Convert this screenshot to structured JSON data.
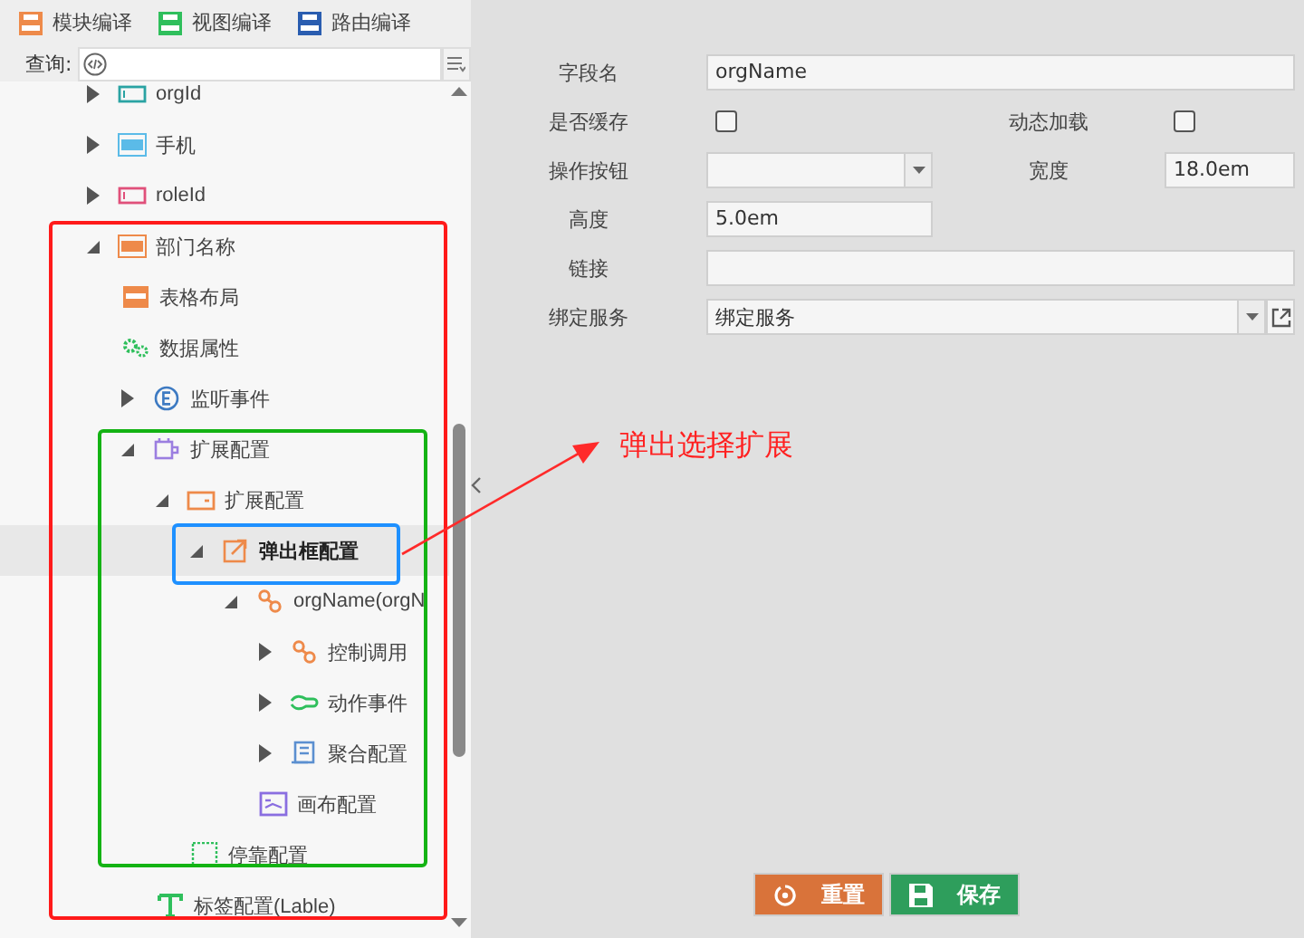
{
  "toolbar": [
    {
      "label": "模块编译"
    },
    {
      "label": "视图编译"
    },
    {
      "label": "路由编译"
    }
  ],
  "search": {
    "label": "查询:"
  },
  "tree": [
    {
      "label": "orgId",
      "expanded": false,
      "selected": false
    },
    {
      "label": "手机",
      "expanded": false,
      "selected": false
    },
    {
      "label": "roleId",
      "expanded": false,
      "selected": false
    },
    {
      "label": "部门名称",
      "expanded": true,
      "selected": false,
      "children": [
        {
          "label": "表格布局",
          "selected": false
        },
        {
          "label": "数据属性",
          "selected": false
        },
        {
          "label": "监听事件",
          "expanded": false,
          "selected": false
        },
        {
          "label": "扩展配置",
          "expanded": true,
          "selected": false,
          "children": [
            {
              "label": "扩展配置",
              "expanded": true,
              "selected": false,
              "children": [
                {
                  "label": "弹出框配置",
                  "expanded": true,
                  "selected": true,
                  "children": [
                    {
                      "label": "orgName(orgN",
                      "expanded": true,
                      "selected": false,
                      "children": [
                        {
                          "label": "控制调用",
                          "expanded": false,
                          "selected": false
                        },
                        {
                          "label": "动作事件",
                          "expanded": false,
                          "selected": false
                        },
                        {
                          "label": "聚合配置",
                          "expanded": false,
                          "selected": false
                        },
                        {
                          "label": "画布配置",
                          "selected": false
                        }
                      ]
                    }
                  ]
                },
                {
                  "label": "停靠配置",
                  "selected": false
                }
              ]
            },
            {
              "label": "标签配置(Lable)",
              "selected": false
            }
          ]
        }
      ]
    }
  ],
  "form": [
    {
      "fields": [
        {
          "kind": "text",
          "label": "字段名",
          "value": "orgName",
          "wide": true
        }
      ]
    },
    {
      "fields": [
        {
          "kind": "checkbox",
          "label": "是否缓存",
          "checked": false
        },
        {
          "kind": "checkbox",
          "label": "动态加载",
          "checked": false
        }
      ]
    },
    {
      "fields": [
        {
          "kind": "select",
          "label": "操作按钮",
          "wide": false
        },
        {
          "kind": "text",
          "label": "宽度",
          "value": "18.0em",
          "wide": false
        }
      ]
    },
    {
      "fields": [
        {
          "kind": "text",
          "label": "高度",
          "value": "5.0em",
          "wide": false
        }
      ]
    },
    {
      "fields": [
        {
          "kind": "text",
          "label": "链接",
          "wide": true
        }
      ]
    },
    {
      "fields": [
        {
          "kind": "select-link",
          "label": "绑定服务",
          "value": "绑定服务",
          "wide": true
        }
      ]
    }
  ],
  "buttons": [
    {
      "label": "重置"
    },
    {
      "label": "保存"
    }
  ],
  "annotation": {
    "text": "弹出选择扩展"
  }
}
